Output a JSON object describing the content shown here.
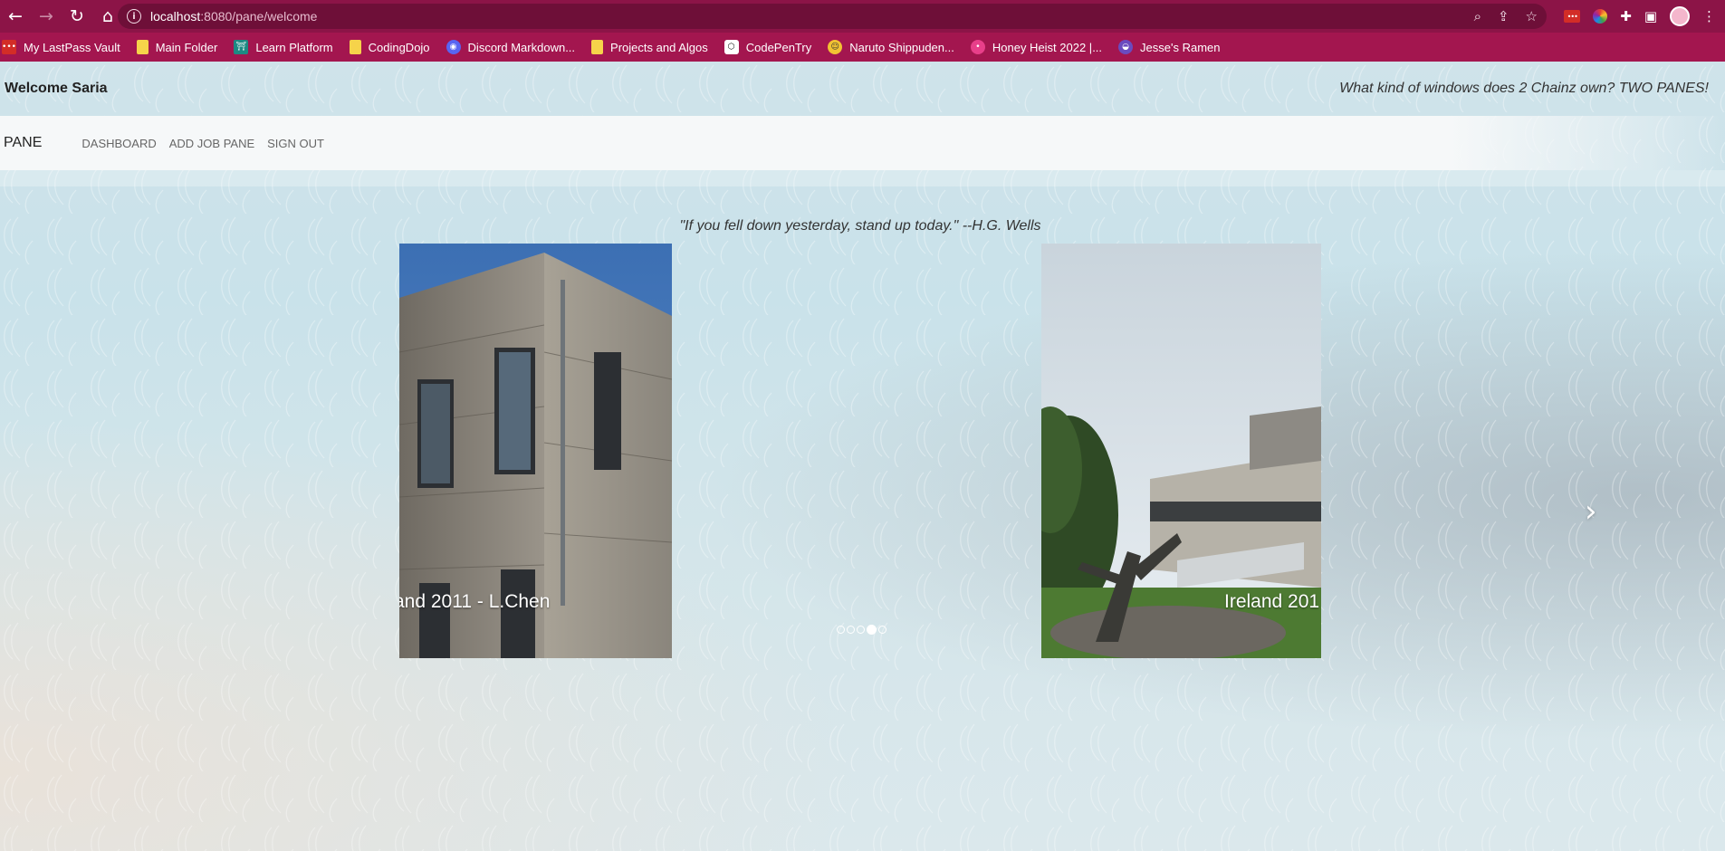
{
  "browser": {
    "url_host": "localhost",
    "url_path": ":8080/pane/welcome",
    "bookmarks": [
      {
        "label": "My LastPass Vault",
        "icon": "lastpass-icon",
        "glyph": "•••"
      },
      {
        "label": "Main Folder",
        "icon": "folder-icon",
        "glyph": ""
      },
      {
        "label": "Learn Platform",
        "icon": "learn-platform-icon",
        "glyph": "⛩"
      },
      {
        "label": "CodingDojo",
        "icon": "folder-icon",
        "glyph": ""
      },
      {
        "label": "Discord Markdown...",
        "icon": "discord-icon",
        "glyph": "◉"
      },
      {
        "label": "Projects and Algos",
        "icon": "folder-icon",
        "glyph": ""
      },
      {
        "label": "CodePenTry",
        "icon": "codepen-icon",
        "glyph": "⬡"
      },
      {
        "label": "Naruto Shippuden...",
        "icon": "naruto-icon",
        "glyph": "☺"
      },
      {
        "label": "Honey Heist 2022 |...",
        "icon": "honey-heist-icon",
        "glyph": "•"
      },
      {
        "label": "Jesse's Ramen",
        "icon": "ramen-icon",
        "glyph": "◒"
      }
    ]
  },
  "header": {
    "welcome": "Welcome Saria",
    "joke": "What kind of windows does 2 Chainz own? TWO PANES!"
  },
  "nav": {
    "brand": "PANE",
    "links": [
      "DASHBOARD",
      "ADD JOB PANE",
      "SIGN OUT"
    ]
  },
  "main": {
    "quote": "\"If you fell down yesterday, stand up today.\" --H.G. Wells",
    "slides": [
      {
        "caption": "and 2011 - L.Chen"
      },
      {
        "caption": "Ireland 201"
      }
    ],
    "indicator_count": 5,
    "active_indicator": 3
  },
  "colors": {
    "chrome": "#8c1447",
    "bookmarks_bar": "#a3164f",
    "navbar": "#f6f8f9"
  }
}
